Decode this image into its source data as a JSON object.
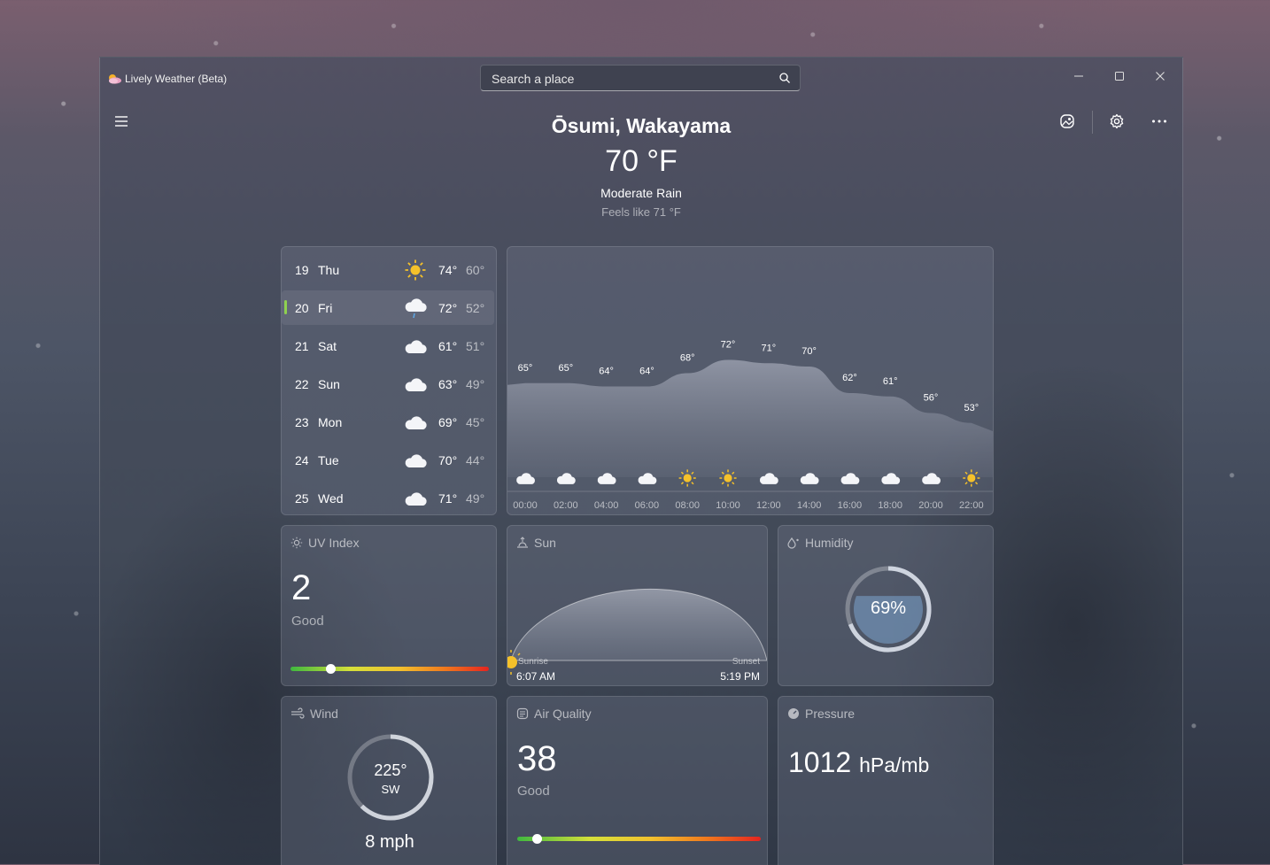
{
  "app": {
    "title": "Lively Weather (Beta)"
  },
  "search": {
    "placeholder": "Search a place"
  },
  "header": {
    "location": "Ōsumi, Wakayama",
    "temperature": "70 °F",
    "condition": "Moderate Rain",
    "feels_like": "Feels like 71 °F"
  },
  "forecast": [
    {
      "day": "19",
      "name": "Thu",
      "icon": "sun-icon",
      "high": "74°",
      "low": "60°",
      "selected": false
    },
    {
      "day": "20",
      "name": "Fri",
      "icon": "cloud-rain-icon",
      "high": "72°",
      "low": "52°",
      "selected": true
    },
    {
      "day": "21",
      "name": "Sat",
      "icon": "cloud-icon",
      "high": "61°",
      "low": "51°",
      "selected": false
    },
    {
      "day": "22",
      "name": "Sun",
      "icon": "cloud-icon",
      "high": "63°",
      "low": "49°",
      "selected": false
    },
    {
      "day": "23",
      "name": "Mon",
      "icon": "cloud-icon",
      "high": "69°",
      "low": "45°",
      "selected": false
    },
    {
      "day": "24",
      "name": "Tue",
      "icon": "cloud-icon",
      "high": "70°",
      "low": "44°",
      "selected": false
    },
    {
      "day": "25",
      "name": "Wed",
      "icon": "cloud-icon",
      "high": "71°",
      "low": "49°",
      "selected": false
    }
  ],
  "hourly": {
    "times": [
      "00:00",
      "02:00",
      "04:00",
      "06:00",
      "08:00",
      "10:00",
      "12:00",
      "14:00",
      "16:00",
      "18:00",
      "20:00",
      "22:00"
    ],
    "temps": [
      65,
      65,
      64,
      64,
      68,
      72,
      71,
      70,
      62,
      61,
      56,
      53
    ],
    "temp_labels": [
      "65°",
      "65°",
      "64°",
      "64°",
      "68°",
      "72°",
      "71°",
      "70°",
      "62°",
      "61°",
      "56°",
      "53°"
    ],
    "icons": [
      "cloud-icon",
      "cloud-icon",
      "cloud-icon",
      "cloud-icon",
      "sun-icon",
      "sun-icon",
      "cloud-icon",
      "cloud-icon",
      "cloud-icon",
      "cloud-icon",
      "cloud-icon",
      "sun-icon"
    ]
  },
  "uv": {
    "title": "UV Index",
    "value": "2",
    "label": "Good",
    "level": 0.2
  },
  "sun": {
    "title": "Sun",
    "sunrise_label": "Sunrise",
    "sunrise": "6:07 AM",
    "sunset_label": "Sunset",
    "sunset": "5:19 PM"
  },
  "humidity": {
    "title": "Humidity",
    "value": "69%",
    "fraction": 0.69
  },
  "wind": {
    "title": "Wind",
    "direction_deg": "225°",
    "direction": "SW",
    "speed": "8 mph",
    "degrees": 225
  },
  "air_quality": {
    "title": "Air Quality",
    "value": "38",
    "label": "Good",
    "level": 0.08
  },
  "pressure": {
    "title": "Pressure",
    "value": "1012",
    "unit": "hPa/mb"
  },
  "colors": {
    "selected_accent": "#8fd14f",
    "sun": "#f5c12a"
  }
}
